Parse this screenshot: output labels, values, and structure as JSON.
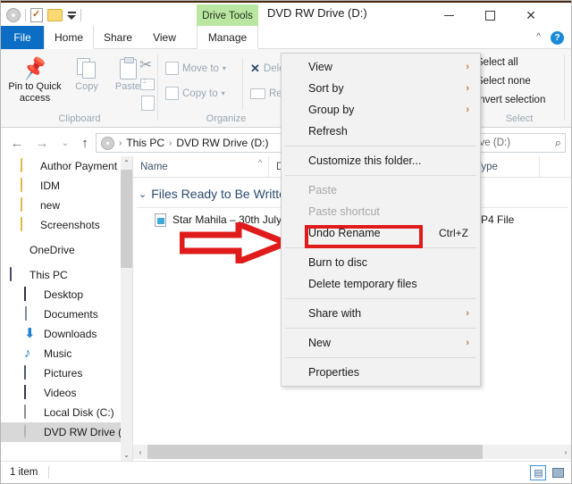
{
  "window": {
    "title": "DVD RW Drive (D:)",
    "contextual_tab_group": "Drive Tools",
    "controls": {
      "minimize": "Minimize",
      "maximize": "Maximize",
      "close": "Close"
    }
  },
  "quick_access_toolbar": {
    "items": [
      {
        "name": "disc-icon",
        "label": ""
      },
      {
        "name": "properties-icon",
        "label": ""
      },
      {
        "name": "new-folder-icon",
        "label": ""
      },
      {
        "name": "customize-qat-caret",
        "label": ""
      }
    ]
  },
  "tabs": [
    {
      "id": "file",
      "label": "File"
    },
    {
      "id": "home",
      "label": "Home"
    },
    {
      "id": "share",
      "label": "Share"
    },
    {
      "id": "view",
      "label": "View"
    },
    {
      "id": "manage",
      "label": "Manage"
    }
  ],
  "ribbon": {
    "collapse_label": "^",
    "help_label": "?",
    "groups": [
      {
        "name": "Clipboard",
        "label": "Clipboard",
        "buttons": [
          {
            "label": "Pin to Quick access",
            "enabled": true
          },
          {
            "label": "Copy",
            "enabled": false
          },
          {
            "label": "Paste",
            "enabled": false
          }
        ]
      },
      {
        "name": "Organize",
        "label": "Organize",
        "buttons": [
          {
            "label": "Move to",
            "enabled": false
          },
          {
            "label": "Copy to",
            "enabled": false
          },
          {
            "label": "Delete",
            "enabled": false
          },
          {
            "label": "Rename",
            "enabled": false
          }
        ]
      },
      {
        "name": "Select",
        "label": "Select",
        "buttons": [
          {
            "label": "Select all",
            "enabled": true
          },
          {
            "label": "Select none",
            "enabled": true
          },
          {
            "label": "Invert selection",
            "enabled": true
          }
        ]
      }
    ]
  },
  "address_bar": {
    "back": "←",
    "forward": "→",
    "recent": "⌄",
    "up": "↑",
    "crumbs": [
      "This PC",
      "DVD RW Drive (D:)"
    ],
    "separator": "›"
  },
  "search": {
    "value": "",
    "placeholder": "Search DVD RW Drive (D:)",
    "visible_text": "ive (D:)",
    "icon": "search-icon"
  },
  "nav_pane": {
    "items": [
      {
        "label": "Author Payment",
        "icon": "folder-icon",
        "indent": 22,
        "selected": false
      },
      {
        "label": "IDM",
        "icon": "folder-icon",
        "indent": 22,
        "selected": false
      },
      {
        "label": "new",
        "icon": "folder-icon",
        "indent": 22,
        "selected": false
      },
      {
        "label": "Screenshots",
        "icon": "folder-icon",
        "indent": 22,
        "selected": false
      },
      {
        "label": "OneDrive",
        "icon": "onedrive-icon",
        "indent": 10,
        "selected": false
      },
      {
        "label": "This PC",
        "icon": "this-pc-icon",
        "indent": 10,
        "selected": false
      },
      {
        "label": "Desktop",
        "icon": "desktop-icon",
        "indent": 22,
        "selected": false
      },
      {
        "label": "Documents",
        "icon": "documents-icon",
        "indent": 22,
        "selected": false
      },
      {
        "label": "Downloads",
        "icon": "downloads-icon",
        "indent": 22,
        "selected": false
      },
      {
        "label": "Music",
        "icon": "music-icon",
        "indent": 22,
        "selected": false
      },
      {
        "label": "Pictures",
        "icon": "pictures-icon",
        "indent": 22,
        "selected": false
      },
      {
        "label": "Videos",
        "icon": "videos-icon",
        "indent": 22,
        "selected": false
      },
      {
        "label": "Local Disk (C:)",
        "icon": "local-disk-icon",
        "indent": 22,
        "selected": false
      },
      {
        "label": "DVD RW Drive (D:)",
        "icon": "dvd-drive-icon",
        "indent": 22,
        "selected": true
      }
    ],
    "scroll_up": "⌃",
    "scroll_down": "⌄"
  },
  "file_list": {
    "columns": [
      "Name",
      "Date modified",
      "Type"
    ],
    "sort_indicator": "^",
    "group_header": "Files Ready to Be Written to the Disc",
    "group_chevron": "⌄",
    "rows": [
      {
        "name": "Star Mahila – 30th July 2018",
        "date_modified": "",
        "type": "MP4 File"
      }
    ],
    "h_scroll_left": "‹",
    "h_scroll_right": "›"
  },
  "context_menu": {
    "items": [
      {
        "label": "View",
        "submenu": true,
        "disabled": false,
        "accel": "",
        "sep_after": false
      },
      {
        "label": "Sort by",
        "submenu": true,
        "disabled": false,
        "accel": "",
        "sep_after": false
      },
      {
        "label": "Group by",
        "submenu": true,
        "disabled": false,
        "accel": "",
        "sep_after": false
      },
      {
        "label": "Refresh",
        "submenu": false,
        "disabled": false,
        "accel": "",
        "sep_after": true
      },
      {
        "label": "Customize this folder...",
        "submenu": false,
        "disabled": false,
        "accel": "",
        "sep_after": true
      },
      {
        "label": "Paste",
        "submenu": false,
        "disabled": true,
        "accel": "",
        "sep_after": false
      },
      {
        "label": "Paste shortcut",
        "submenu": false,
        "disabled": true,
        "accel": "",
        "sep_after": false
      },
      {
        "label": "Undo Rename",
        "submenu": false,
        "disabled": false,
        "accel": "Ctrl+Z",
        "sep_after": true
      },
      {
        "label": "Burn to disc",
        "submenu": false,
        "disabled": false,
        "accel": "",
        "sep_after": false,
        "highlighted": true
      },
      {
        "label": "Delete temporary files",
        "submenu": false,
        "disabled": false,
        "accel": "",
        "sep_after": true
      },
      {
        "label": "Share with",
        "submenu": true,
        "disabled": false,
        "accel": "",
        "sep_after": true
      },
      {
        "label": "New",
        "submenu": true,
        "disabled": false,
        "accel": "",
        "sep_after": true
      },
      {
        "label": "Properties",
        "submenu": false,
        "disabled": false,
        "accel": "",
        "sep_after": false
      }
    ],
    "submenu_arrow": "›"
  },
  "annotation": {
    "arrow_color": "#e01b1b",
    "highlight_color": "#e01b1b",
    "target_item": "Burn to disc"
  },
  "status_bar": {
    "item_count": "1 item",
    "view_buttons": [
      {
        "name": "details-view",
        "label": "Details view",
        "active": true
      },
      {
        "name": "thumbnail-view",
        "label": "Large icons view",
        "active": false
      }
    ]
  },
  "colors": {
    "file_tab": "#0b6ec4",
    "contextual_tab": "#b9e6a0",
    "accent": "#1a8bd8",
    "selection": "#d8d8d8"
  }
}
